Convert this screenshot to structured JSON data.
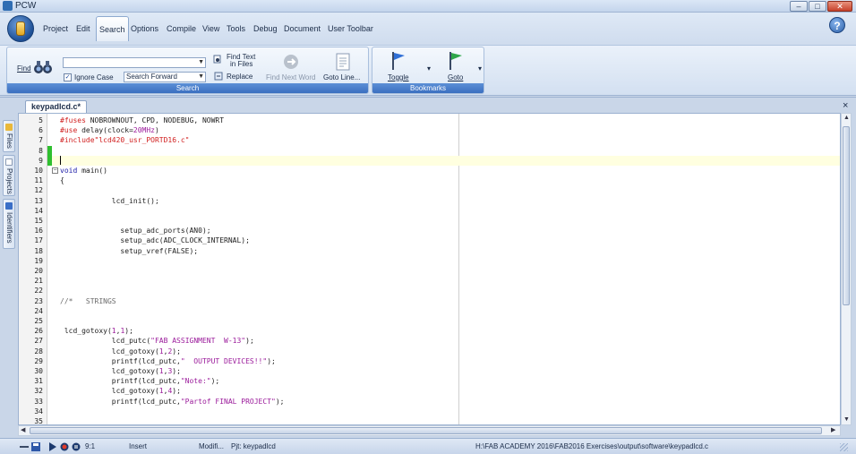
{
  "window": {
    "title": "PCW",
    "buttons": {
      "minimize": "–",
      "maximize": "□",
      "close": "✕"
    }
  },
  "menu": {
    "items": [
      {
        "label": "Project",
        "active": false
      },
      {
        "label": "Edit",
        "active": false
      },
      {
        "label": "Search",
        "active": true
      },
      {
        "label": "Options",
        "active": false
      },
      {
        "label": "Compile",
        "active": false
      },
      {
        "label": "View",
        "active": false
      },
      {
        "label": "Tools",
        "active": false
      },
      {
        "label": "Debug",
        "active": false
      },
      {
        "label": "Document",
        "active": false
      },
      {
        "label": "User Toolbar",
        "active": false
      }
    ],
    "help_label": "?"
  },
  "ribbon": {
    "search_group": {
      "label": "Search",
      "find_label": "Find",
      "find_value": "",
      "ignore_case_label": "Ignore Case",
      "ignore_case_checked": true,
      "direction_value": "Search Forward",
      "find_in_files_label_1": "Find Text",
      "find_in_files_label_2": "in Files",
      "replace_label": "Replace",
      "find_next_word_label": "Find Next Word",
      "goto_line_label": "Goto Line..."
    },
    "bookmarks_group": {
      "label": "Bookmarks",
      "toggle_label": "Toggle",
      "goto_label": "Goto"
    }
  },
  "editor": {
    "tab_label": "keypadlcd.c*",
    "current_line": 9,
    "lines": [
      {
        "n": "5",
        "tokens": [
          {
            "t": "#fuses ",
            "c": "pre"
          },
          {
            "t": "NOBROWNOUT, CPD, NODEBUG, NOWRT",
            "c": "txt"
          }
        ]
      },
      {
        "n": "6",
        "tokens": [
          {
            "t": "#use ",
            "c": "pre"
          },
          {
            "t": "delay(clock=",
            "c": "txt"
          },
          {
            "t": "20MHz",
            "c": "num"
          },
          {
            "t": ")",
            "c": "txt"
          }
        ]
      },
      {
        "n": "7",
        "tokens": [
          {
            "t": "#include\"lcd420_usr_PORTD16.c\"",
            "c": "pre"
          }
        ]
      },
      {
        "n": "8",
        "tokens": []
      },
      {
        "n": "9",
        "tokens": []
      },
      {
        "n": "10",
        "tokens": [
          {
            "t": "void ",
            "c": "kw"
          },
          {
            "t": "main()",
            "c": "txt"
          }
        ],
        "fold": true
      },
      {
        "n": "11",
        "tokens": [
          {
            "t": "{",
            "c": "txt"
          }
        ]
      },
      {
        "n": "12",
        "tokens": []
      },
      {
        "n": "13",
        "tokens": [
          {
            "t": "            lcd_init();",
            "c": "txt"
          }
        ]
      },
      {
        "n": "14",
        "tokens": []
      },
      {
        "n": "15",
        "tokens": []
      },
      {
        "n": "16",
        "tokens": [
          {
            "t": "              setup_adc_ports(AN0);",
            "c": "txt"
          }
        ]
      },
      {
        "n": "17",
        "tokens": [
          {
            "t": "              setup_adc(ADC_CLOCK_INTERNAL);",
            "c": "txt"
          }
        ]
      },
      {
        "n": "18",
        "tokens": [
          {
            "t": "              setup_vref(FALSE);",
            "c": "txt"
          }
        ]
      },
      {
        "n": "19",
        "tokens": []
      },
      {
        "n": "20",
        "tokens": []
      },
      {
        "n": "21",
        "tokens": []
      },
      {
        "n": "22",
        "tokens": []
      },
      {
        "n": "23",
        "tokens": [
          {
            "t": "//*   STRINGS",
            "c": "com"
          }
        ]
      },
      {
        "n": "24",
        "tokens": []
      },
      {
        "n": "25",
        "tokens": []
      },
      {
        "n": "26",
        "tokens": [
          {
            "t": " lcd_gotoxy(",
            "c": "txt"
          },
          {
            "t": "1",
            "c": "num"
          },
          {
            "t": ",",
            "c": "txt"
          },
          {
            "t": "1",
            "c": "num"
          },
          {
            "t": ");",
            "c": "txt"
          }
        ]
      },
      {
        "n": "27",
        "tokens": [
          {
            "t": "            lcd_putc(",
            "c": "txt"
          },
          {
            "t": "\"FAB ASSIGNMENT  W-13\"",
            "c": "str"
          },
          {
            "t": ");",
            "c": "txt"
          }
        ]
      },
      {
        "n": "28",
        "tokens": [
          {
            "t": "            lcd_gotoxy(",
            "c": "txt"
          },
          {
            "t": "1",
            "c": "num"
          },
          {
            "t": ",",
            "c": "txt"
          },
          {
            "t": "2",
            "c": "num"
          },
          {
            "t": ");",
            "c": "txt"
          }
        ]
      },
      {
        "n": "29",
        "tokens": [
          {
            "t": "            printf(lcd_putc,",
            "c": "txt"
          },
          {
            "t": "\"  OUTPUT DEVICES!!\"",
            "c": "str"
          },
          {
            "t": ");",
            "c": "txt"
          }
        ]
      },
      {
        "n": "30",
        "tokens": [
          {
            "t": "            lcd_gotoxy(",
            "c": "txt"
          },
          {
            "t": "1",
            "c": "num"
          },
          {
            "t": ",",
            "c": "txt"
          },
          {
            "t": "3",
            "c": "num"
          },
          {
            "t": ");",
            "c": "txt"
          }
        ]
      },
      {
        "n": "31",
        "tokens": [
          {
            "t": "            printf(lcd_putc,",
            "c": "txt"
          },
          {
            "t": "\"Note:\"",
            "c": "str"
          },
          {
            "t": ");",
            "c": "txt"
          }
        ]
      },
      {
        "n": "32",
        "tokens": [
          {
            "t": "            lcd_gotoxy(",
            "c": "txt"
          },
          {
            "t": "1",
            "c": "num"
          },
          {
            "t": ",",
            "c": "txt"
          },
          {
            "t": "4",
            "c": "num"
          },
          {
            "t": ");",
            "c": "txt"
          }
        ]
      },
      {
        "n": "33",
        "tokens": [
          {
            "t": "            printf(lcd_putc,",
            "c": "txt"
          },
          {
            "t": "\"Partof FINAL PROJECT\"",
            "c": "str"
          },
          {
            "t": ");",
            "c": "txt"
          }
        ]
      },
      {
        "n": "34",
        "tokens": []
      },
      {
        "n": "35",
        "tokens": []
      }
    ]
  },
  "side_tabs": [
    "Files",
    "Projects",
    "Identifiers"
  ],
  "status": {
    "position": "9:1",
    "mode": "Insert",
    "modified": "Modifi...",
    "project": "Pjt: keypadlcd",
    "path": "H:\\FAB ACADEMY 2016\\FAB2016 Exercises\\output\\software\\keypadlcd.c"
  },
  "colors": {
    "accent": "#3a6fc0",
    "preprocessor": "#d11f1f",
    "keyword": "#1a1aa6",
    "string": "#9b1b9b",
    "line_marker_green": "#2fbf2f",
    "line_marker_yellow": "#e8e04a"
  },
  "icons": {
    "find": "binoculars-icon",
    "find_in_files": "find-in-files-icon",
    "replace": "replace-icon",
    "find_next_word": "find-next-word-icon",
    "goto_line": "goto-line-icon",
    "toggle_bookmark": "blue-flag-icon",
    "goto_bookmark": "green-flag-icon"
  }
}
